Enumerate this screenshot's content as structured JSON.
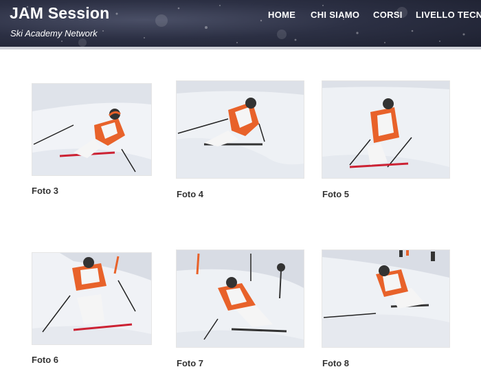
{
  "header": {
    "title": "JAM Session",
    "subtitle": "Ski Academy Network",
    "nav": [
      "HOME",
      "CHI SIAMO",
      "CORSI",
      "LIVELLO TECNI"
    ]
  },
  "gallery": {
    "items": [
      {
        "caption": "Foto 3",
        "image": "skier-turn-photo"
      },
      {
        "caption": "Foto 4",
        "image": "skier-turn-photo"
      },
      {
        "caption": "Foto 5",
        "image": "skier-turn-photo"
      },
      {
        "caption": "Foto 6",
        "image": "skier-turn-photo"
      },
      {
        "caption": "Foto 7",
        "image": "skier-turn-photo"
      },
      {
        "caption": "Foto 8",
        "image": "skier-turn-photo"
      }
    ]
  },
  "colors": {
    "header_bg": "#2c3044",
    "suit_orange": "#e8622a",
    "suit_white": "#f5f5f5",
    "snow": "#eef1f6"
  }
}
